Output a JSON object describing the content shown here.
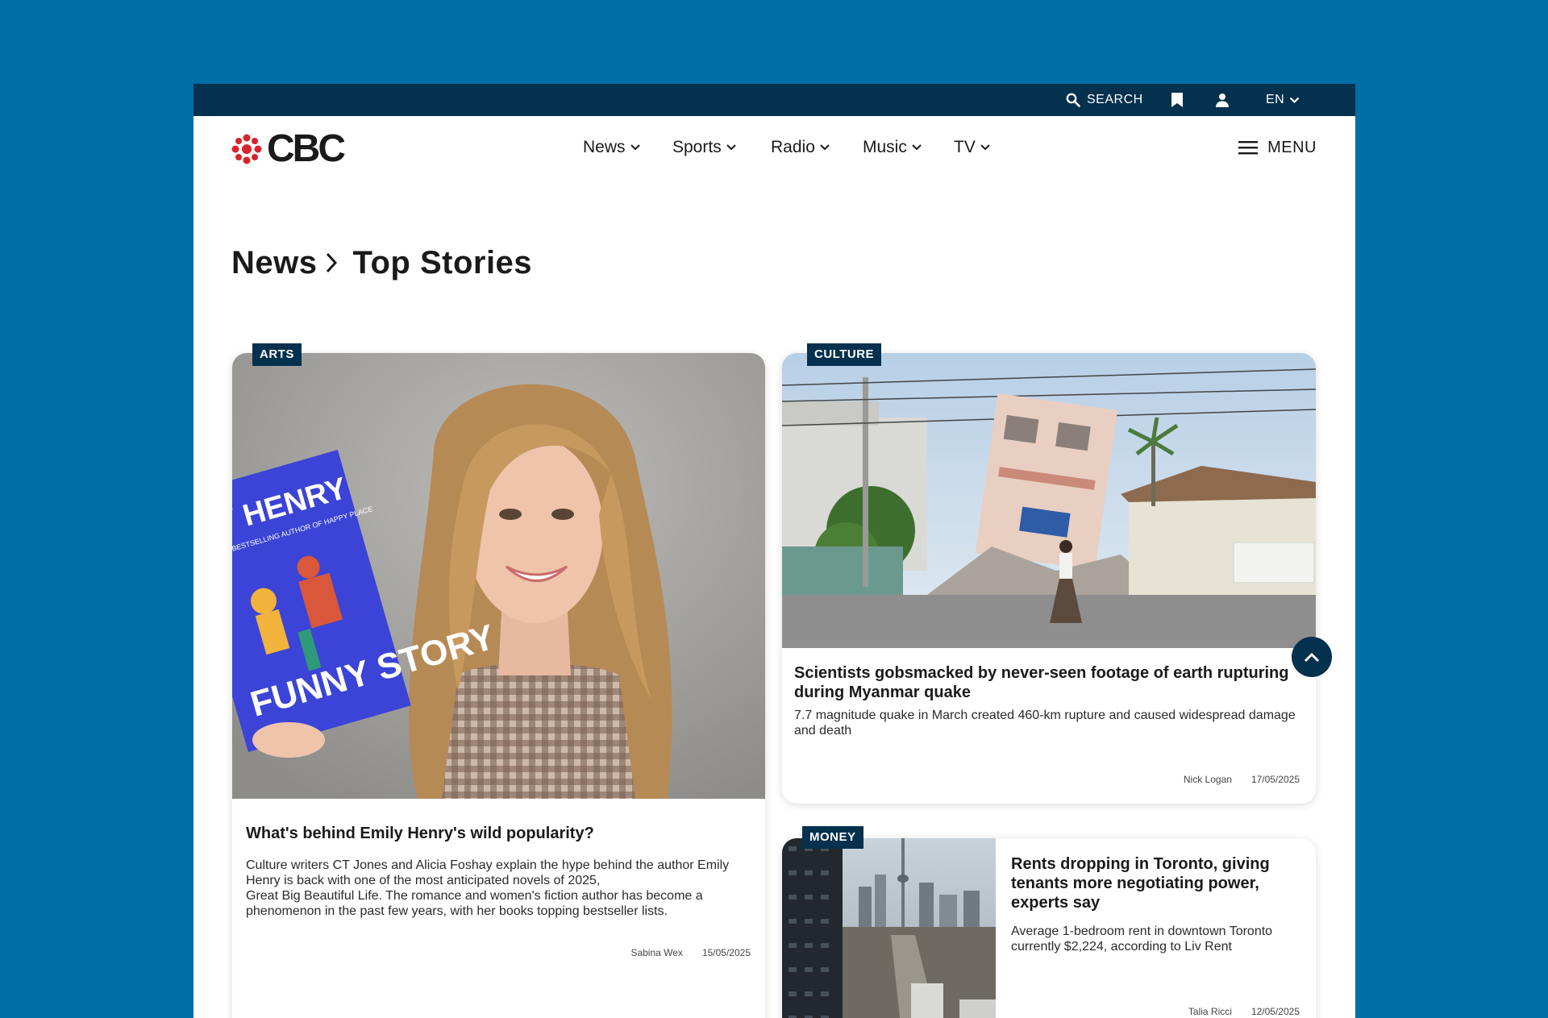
{
  "utility": {
    "search_label": "SEARCH",
    "lang_label": "EN"
  },
  "nav": {
    "logo_text": "CBC",
    "items": [
      {
        "label": "News"
      },
      {
        "label": "Sports"
      },
      {
        "label": "Radio"
      },
      {
        "label": "Music"
      },
      {
        "label": "TV"
      }
    ],
    "menu_label": "MENU"
  },
  "breadcrumb": {
    "parent": "News",
    "current": "Top Stories"
  },
  "stories": [
    {
      "tag": "ARTS",
      "title": "What's behind Emily Henry's wild popularity?",
      "description": "Culture writers CT Jones and Alicia Foshay explain the hype behind the author Emily Henry is back with one of the most anticipated novels of 2025,                                                     Great Big Beautiful Life. The romance and women's fiction author has become a phenomenon in the past few years, with her books topping bestseller lists.",
      "author": "Sabina Wex",
      "date": "15/05/2025",
      "book_title_top": "Y HENRY",
      "book_subtitle": "TIMES BESTSELLING AUTHOR OF HAPPY PLACE",
      "book_title_bottom": "FUNNY STORY"
    },
    {
      "tag": "CULTURE",
      "title": "Scientists gobsmacked by never-seen footage of earth rupturing during Myanmar quake",
      "description": "7.7 magnitude quake in March created 460-km rupture and caused widespread damage and death",
      "author": "Nick Logan",
      "date": "17/05/2025"
    },
    {
      "tag": "MONEY",
      "title": "Rents dropping in Toronto, giving tenants more negotiating power, experts say",
      "description": "Average 1-bedroom rent in downtown Toronto currently $2,224, according to Liv Rent",
      "author": "Talia Ricci",
      "date": "12/05/2025"
    }
  ],
  "colors": {
    "background": "#006ea6",
    "brand_dark": "#04314d",
    "logo_red": "#d8232a"
  }
}
